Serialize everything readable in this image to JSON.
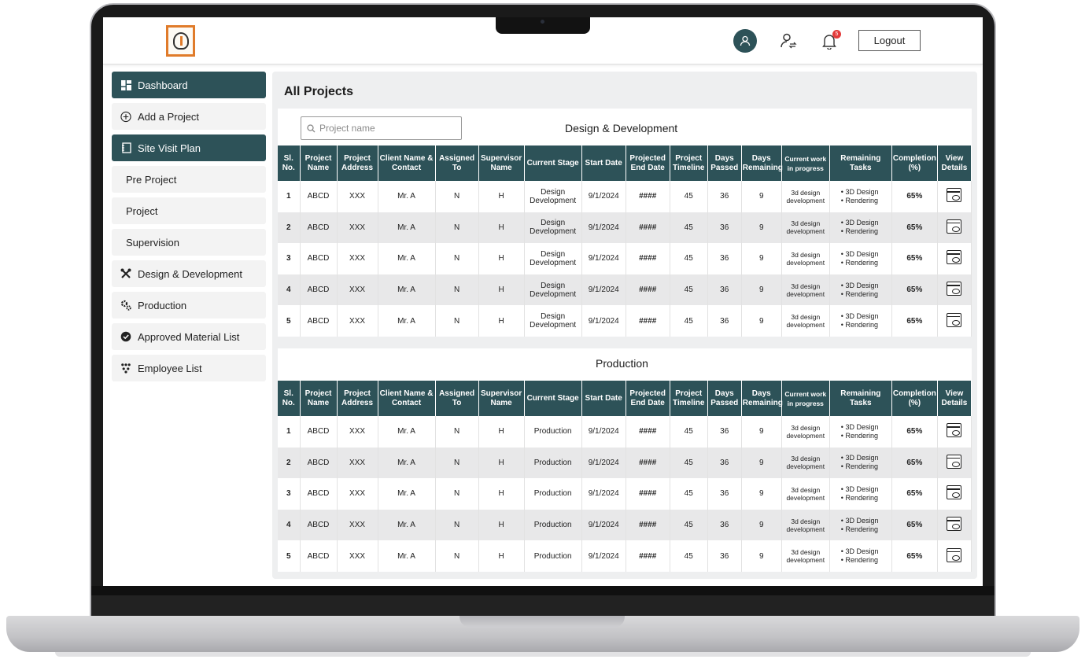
{
  "header": {
    "logout_label": "Logout",
    "notification_count": "5"
  },
  "sidebar": {
    "items": [
      {
        "label": "Dashboard",
        "icon": "dashboard-icon",
        "active": true
      },
      {
        "label": "Add a Project",
        "icon": "plus-circle-icon"
      },
      {
        "label": "Site Visit Plan",
        "icon": "notebook-icon",
        "active": true
      },
      {
        "label": "Pre Project",
        "sub": true
      },
      {
        "label": "Project",
        "sub": true
      },
      {
        "label": "Supervision",
        "sub": true
      },
      {
        "label": "Design & Development",
        "icon": "tools-icon"
      },
      {
        "label": "Production",
        "icon": "gears-icon"
      },
      {
        "label": "Approved Material List",
        "icon": "check-badge-icon"
      },
      {
        "label": "Employee List",
        "icon": "org-chart-icon"
      }
    ]
  },
  "main": {
    "title": "All Projects",
    "search_placeholder": "Project name",
    "columns": [
      "Sl. No.",
      "Project Name",
      "Project Address",
      "Client Name & Contact",
      "Assigned To",
      "Supervisor Name",
      "Current Stage",
      "Start Date",
      "Projected End Date",
      "Project Timeline",
      "Days Passed",
      "Days Remaining",
      "Current work in progress",
      "Remaining Tasks",
      "Completion (%)",
      "View Details"
    ],
    "sections": [
      {
        "title": "Design & Development",
        "rows": [
          {
            "sl": "1",
            "name": "ABCD",
            "address": "XXX",
            "client": "Mr. A",
            "assigned": "N",
            "supervisor": "H",
            "stage": "Design Development",
            "start": "9/1/2024",
            "end": "####",
            "timeline": "45",
            "passed": "36",
            "remaining": "9",
            "wip": "3d design development",
            "task1": "3D Design",
            "task2": "Rendering",
            "completion": "65%"
          },
          {
            "sl": "2",
            "name": "ABCD",
            "address": "XXX",
            "client": "Mr. A",
            "assigned": "N",
            "supervisor": "H",
            "stage": "Design Development",
            "start": "9/1/2024",
            "end": "####",
            "timeline": "45",
            "passed": "36",
            "remaining": "9",
            "wip": "3d design development",
            "task1": "3D Design",
            "task2": "Rendering",
            "completion": "65%"
          },
          {
            "sl": "3",
            "name": "ABCD",
            "address": "XXX",
            "client": "Mr. A",
            "assigned": "N",
            "supervisor": "H",
            "stage": "Design Development",
            "start": "9/1/2024",
            "end": "####",
            "timeline": "45",
            "passed": "36",
            "remaining": "9",
            "wip": "3d design development",
            "task1": "3D Design",
            "task2": "Rendering",
            "completion": "65%"
          },
          {
            "sl": "4",
            "name": "ABCD",
            "address": "XXX",
            "client": "Mr. A",
            "assigned": "N",
            "supervisor": "H",
            "stage": "Design Development",
            "start": "9/1/2024",
            "end": "####",
            "timeline": "45",
            "passed": "36",
            "remaining": "9",
            "wip": "3d design development",
            "task1": "3D Design",
            "task2": "Rendering",
            "completion": "65%"
          },
          {
            "sl": "5",
            "name": "ABCD",
            "address": "XXX",
            "client": "Mr. A",
            "assigned": "N",
            "supervisor": "H",
            "stage": "Design Development",
            "start": "9/1/2024",
            "end": "####",
            "timeline": "45",
            "passed": "36",
            "remaining": "9",
            "wip": "3d design development",
            "task1": "3D Design",
            "task2": "Rendering",
            "completion": "65%"
          }
        ]
      },
      {
        "title": "Production",
        "rows": [
          {
            "sl": "1",
            "name": "ABCD",
            "address": "XXX",
            "client": "Mr. A",
            "assigned": "N",
            "supervisor": "H",
            "stage": "Production",
            "start": "9/1/2024",
            "end": "####",
            "timeline": "45",
            "passed": "36",
            "remaining": "9",
            "wip": "3d design development",
            "task1": "3D Design",
            "task2": "Rendering",
            "completion": "65%"
          },
          {
            "sl": "2",
            "name": "ABCD",
            "address": "XXX",
            "client": "Mr. A",
            "assigned": "N",
            "supervisor": "H",
            "stage": "Production",
            "start": "9/1/2024",
            "end": "####",
            "timeline": "45",
            "passed": "36",
            "remaining": "9",
            "wip": "3d design development",
            "task1": "3D Design",
            "task2": "Rendering",
            "completion": "65%"
          },
          {
            "sl": "3",
            "name": "ABCD",
            "address": "XXX",
            "client": "Mr. A",
            "assigned": "N",
            "supervisor": "H",
            "stage": "Production",
            "start": "9/1/2024",
            "end": "####",
            "timeline": "45",
            "passed": "36",
            "remaining": "9",
            "wip": "3d design development",
            "task1": "3D Design",
            "task2": "Rendering",
            "completion": "65%"
          },
          {
            "sl": "4",
            "name": "ABCD",
            "address": "XXX",
            "client": "Mr. A",
            "assigned": "N",
            "supervisor": "H",
            "stage": "Production",
            "start": "9/1/2024",
            "end": "####",
            "timeline": "45",
            "passed": "36",
            "remaining": "9",
            "wip": "3d design development",
            "task1": "3D Design",
            "task2": "Rendering",
            "completion": "65%"
          },
          {
            "sl": "5",
            "name": "ABCD",
            "address": "XXX",
            "client": "Mr. A",
            "assigned": "N",
            "supervisor": "H",
            "stage": "Production",
            "start": "9/1/2024",
            "end": "####",
            "timeline": "45",
            "passed": "36",
            "remaining": "9",
            "wip": "3d design development",
            "task1": "3D Design",
            "task2": "Rendering",
            "completion": "65%"
          }
        ]
      }
    ]
  },
  "colors": {
    "primary": "#2d5258",
    "notification_badge": "#e33b3b",
    "logo_accent": "#e07b2a"
  }
}
